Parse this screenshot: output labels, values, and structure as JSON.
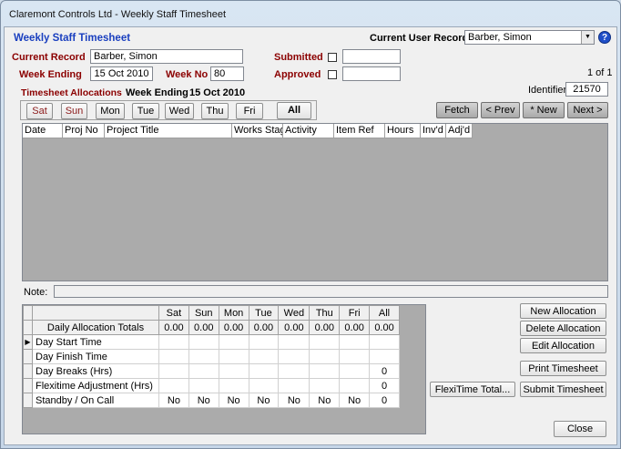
{
  "window": {
    "title": "Claremont Controls Ltd - Weekly Staff Timesheet"
  },
  "header": {
    "form_title": "Weekly Staff Timesheet",
    "current_user_label": "Current User Record",
    "current_user_value": "Barber, Simon",
    "help_glyph": "?"
  },
  "record": {
    "current_record_label": "Current Record",
    "current_record_value": "Barber, Simon",
    "week_ending_label": "Week Ending",
    "week_ending_value": "15 Oct 2010",
    "week_no_label": "Week No",
    "week_no_value": "80",
    "submitted_label": "Submitted",
    "approved_label": "Approved",
    "submitted_checked": false,
    "approved_checked": false,
    "submitted_value": "",
    "approved_value": "",
    "record_position": "1 of 1",
    "identifier_label": "Identifier",
    "identifier_value": "21570"
  },
  "allocations_header": {
    "label": "Timesheet Allocations",
    "week_ending_label": "Week Ending",
    "week_ending_value": "15 Oct 2010"
  },
  "day_tabs": [
    "Sat",
    "Sun",
    "Mon",
    "Tue",
    "Wed",
    "Thu",
    "Fri"
  ],
  "all_tab": "All",
  "nav_buttons": {
    "fetch": "Fetch",
    "prev": "< Prev",
    "new": "* New",
    "next": "Next >"
  },
  "grid": {
    "columns": [
      "Date",
      "Proj No",
      "Project Title",
      "Works Stage",
      "Activity",
      "Item Ref",
      "Hours",
      "Inv'd",
      "Adj'd"
    ]
  },
  "note": {
    "label": "Note:",
    "value": ""
  },
  "summary": {
    "columns": [
      "Sat",
      "Sun",
      "Mon",
      "Tue",
      "Wed",
      "Thu",
      "Fri",
      "All"
    ],
    "totals_label": "Daily Allocation Totals",
    "totals": [
      "0.00",
      "0.00",
      "0.00",
      "0.00",
      "0.00",
      "0.00",
      "0.00",
      "0.00"
    ],
    "row_marker": "▶",
    "rows": [
      {
        "label": "Day Start Time",
        "values": [
          "",
          "",
          "",
          "",
          "",
          "",
          "",
          ""
        ]
      },
      {
        "label": "Day Finish Time",
        "values": [
          "",
          "",
          "",
          "",
          "",
          "",
          "",
          ""
        ]
      },
      {
        "label": "Day Breaks (Hrs)",
        "values": [
          "",
          "",
          "",
          "",
          "",
          "",
          "",
          "0"
        ]
      },
      {
        "label": "Flexitime Adjustment (Hrs)",
        "values": [
          "",
          "",
          "",
          "",
          "",
          "",
          "",
          "0"
        ]
      },
      {
        "label": "Standby / On Call",
        "values": [
          "No",
          "No",
          "No",
          "No",
          "No",
          "No",
          "No",
          "0"
        ]
      }
    ]
  },
  "actions": {
    "new_allocation": "New Allocation",
    "delete_allocation": "Delete Allocation",
    "edit_allocation": "Edit Allocation",
    "print_timesheet": "Print Timesheet",
    "flexitime_total": "FlexiTime Total...",
    "submit_timesheet": "Submit Timesheet",
    "close": "Close"
  },
  "colors": {
    "title_blue": "#1a3fbf",
    "label_red": "#8b0000",
    "grid_background": "#ababab"
  }
}
